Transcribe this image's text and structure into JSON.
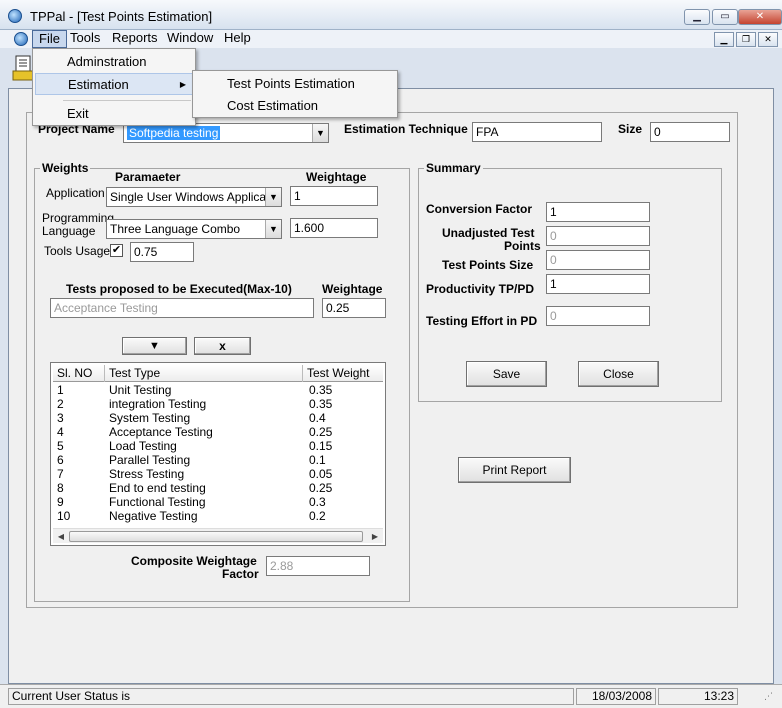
{
  "window": {
    "title": "TPPal - [Test Points Estimation]"
  },
  "menubar": {
    "items": [
      "File",
      "Tools",
      "Reports",
      "Window",
      "Help"
    ]
  },
  "file_menu": {
    "items": [
      "Adminstration",
      "Estimation",
      "Exit"
    ]
  },
  "estimation_submenu": {
    "items": [
      "Test Points Estimation",
      "Cost Estimation"
    ]
  },
  "project": {
    "name_label": "Project Name",
    "name_value": "Softpedia testing",
    "technique_label": "Estimation Technique",
    "technique_value": "FPA",
    "size_label": "Size",
    "size_value": "0"
  },
  "weights": {
    "group_title": "Weights",
    "param_header": "Paramaeter",
    "weight_header": "Weightage",
    "application_label": "Application",
    "application_value": "Single User Windows Application",
    "application_weight": "1",
    "language_label_1": "Programming",
    "language_label_2": "Language",
    "language_value": "Three Language Combo",
    "language_weight": "1.600",
    "tools_label": "Tools Usage",
    "tools_checked": "✔",
    "tools_weight": "0.75",
    "tests_header": "Tests proposed to be Executed(Max-10)",
    "tests_weight_header": "Weightage",
    "test_value": "Acceptance Testing",
    "test_weight": "0.25",
    "add_button": "▼",
    "remove_button": "x"
  },
  "tests_list": {
    "columns": [
      "Sl. NO",
      "Test Type",
      "Test Weight"
    ],
    "rows": [
      [
        "1",
        "Unit Testing",
        "0.35"
      ],
      [
        "2",
        "integration Testing",
        "0.35"
      ],
      [
        "3",
        "System Testing",
        "0.4"
      ],
      [
        "4",
        "Acceptance Testing",
        "0.25"
      ],
      [
        "5",
        "Load Testing",
        "0.15"
      ],
      [
        "6",
        "Parallel Testing",
        "0.1"
      ],
      [
        "7",
        "Stress Testing",
        "0.05"
      ],
      [
        "8",
        "End to end testing",
        "0.25"
      ],
      [
        "9",
        "Functional Testing",
        "0.3"
      ],
      [
        "10",
        "Negative Testing",
        "0.2"
      ]
    ]
  },
  "composite": {
    "label_1": "Composite Weightage",
    "label_2": "Factor",
    "value": "2.88"
  },
  "summary": {
    "group_title": "Summary",
    "conversion_label": "Conversion Factor",
    "conversion_value": "1",
    "unadjusted_label_1": "Unadjusted Test",
    "unadjusted_label_2": "Points",
    "unadjusted_value": "0",
    "size_label": "Test Points Size",
    "size_value": "0",
    "productivity_label": "Productivity TP/PD",
    "productivity_value": "1",
    "effort_label": "Testing Effort in PD",
    "effort_value": "0",
    "save_button": "Save",
    "close_button": "Close"
  },
  "print_button": "Print Report",
  "statusbar": {
    "user_status": "Current User Status is",
    "date": "18/03/2008",
    "time": "13:23"
  }
}
